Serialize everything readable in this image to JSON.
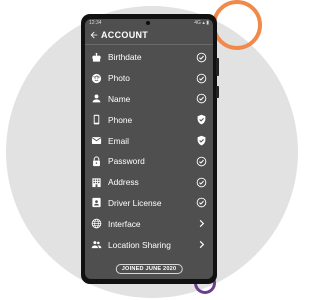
{
  "header": {
    "title": "ACCOUNT",
    "status_time": "12:34",
    "status_icons": "4G ▴ ▮"
  },
  "rows": [
    {
      "label": "Birthdate",
      "icon": "cake-icon",
      "trail": "check-circle-icon"
    },
    {
      "label": "Photo",
      "icon": "face-icon",
      "trail": "check-circle-icon"
    },
    {
      "label": "Name",
      "icon": "person-icon",
      "trail": "check-circle-icon"
    },
    {
      "label": "Phone",
      "icon": "phone-icon",
      "trail": "verified-shield-icon"
    },
    {
      "label": "Email",
      "icon": "mail-icon",
      "trail": "verified-shield-icon"
    },
    {
      "label": "Password",
      "icon": "lock-icon",
      "trail": "check-circle-icon"
    },
    {
      "label": "Address",
      "icon": "building-icon",
      "trail": "check-circle-icon"
    },
    {
      "label": "Driver License",
      "icon": "id-card-icon",
      "trail": "check-circle-icon"
    },
    {
      "label": "Interface",
      "icon": "globe-icon",
      "trail": "chevron-right-icon"
    },
    {
      "label": "Location Sharing",
      "icon": "group-icon",
      "trail": "chevron-right-icon"
    }
  ],
  "footer": {
    "joined": "JOINED JUNE 2020"
  }
}
